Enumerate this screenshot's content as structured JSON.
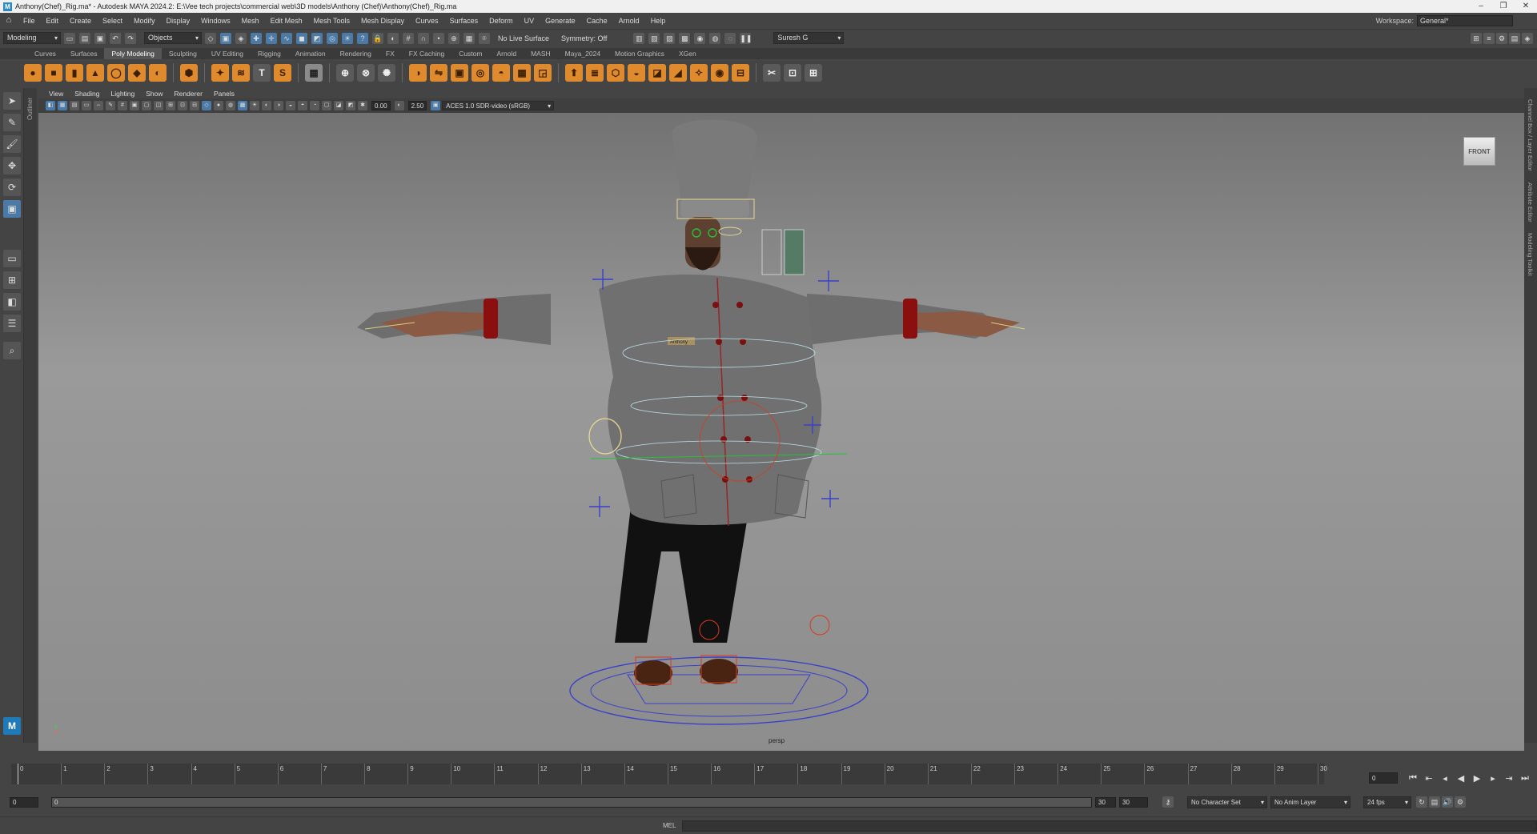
{
  "titlebar": {
    "title": "Anthony(Chef)_Rig.ma* - Autodesk MAYA 2024.2: E:\\Vee tech projects\\commercial web\\3D models\\Anthony (Chef)\\Anthony(Chef)_Rig.ma"
  },
  "menubar": {
    "items": [
      "File",
      "Edit",
      "Create",
      "Select",
      "Modify",
      "Display",
      "Windows",
      "Mesh",
      "Edit Mesh",
      "Mesh Tools",
      "Mesh Display",
      "Curves",
      "Surfaces",
      "Deform",
      "UV",
      "Generate",
      "Cache",
      "Arnold",
      "Help"
    ],
    "workspace_label": "Workspace:",
    "workspace_value": "General*"
  },
  "statusline": {
    "mode": "Modeling",
    "selection": "Objects",
    "live_surface": "No Live Surface",
    "symmetry": "Symmetry: Off",
    "user": "Suresh G"
  },
  "shelf": {
    "tabs": [
      "Curves",
      "Surfaces",
      "Poly Modeling",
      "Sculpting",
      "UV Editing",
      "Rigging",
      "Animation",
      "Rendering",
      "FX",
      "FX Caching",
      "Custom",
      "Arnold",
      "MASH",
      "Maya_2024",
      "Motion Graphics",
      "XGen"
    ],
    "active_tab": "Poly Modeling"
  },
  "outliner": {
    "label": "Outliner"
  },
  "viewport": {
    "menu": [
      "View",
      "Shading",
      "Lighting",
      "Show",
      "Renderer",
      "Panels"
    ],
    "exposure": "0.00",
    "gamma": "2.50",
    "color_space": "ACES 1.0 SDR-video (sRGB)",
    "camera": "persp",
    "viewcube": "FRONT",
    "nametag": "Anthony"
  },
  "right_panels": [
    "Channel Box / Layer Editor",
    "Attribute Editor",
    "Modeling Toolkit"
  ],
  "timeline": {
    "ticks": [
      "1",
      "2",
      "3",
      "4",
      "5",
      "6",
      "7",
      "8",
      "9",
      "10",
      "11",
      "12",
      "13",
      "14",
      "15",
      "16",
      "17",
      "18",
      "19",
      "20",
      "21",
      "22",
      "23",
      "24",
      "25",
      "26",
      "27",
      "28",
      "29",
      "30"
    ],
    "current_frame": "0",
    "range_start": "0",
    "range_inner_start": "0",
    "range_inner_end": "30",
    "range_end": "30",
    "char_set": "No Character Set",
    "anim_layer": "No Anim Layer",
    "fps": "24 fps"
  },
  "cmdline": {
    "label": "MEL"
  }
}
